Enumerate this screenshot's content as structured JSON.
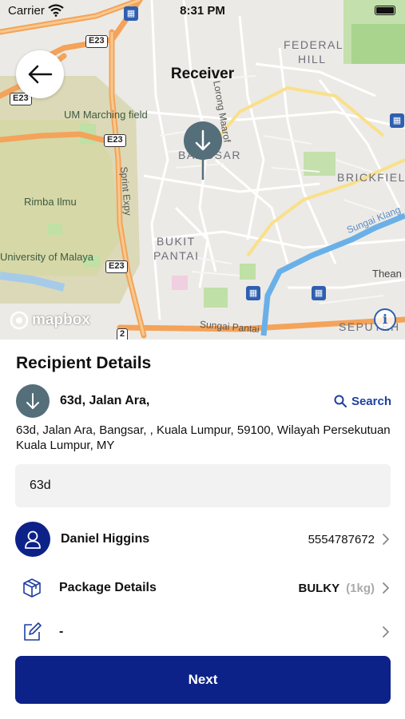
{
  "status_bar": {
    "carrier": "Carrier",
    "time": "8:31 PM"
  },
  "nav": {
    "title": "Receiver"
  },
  "map": {
    "attribution": "mapbox",
    "areas": [
      "FEDERAL",
      "HILL",
      "BANGSAR",
      "BUKIT",
      "PANTAI",
      "BRICKFIEL",
      "SEPUTEH"
    ],
    "places": [
      "UM Marching field",
      "Rimba Ilmu",
      "University of Malaya",
      "Thean"
    ],
    "roads": [
      "Lorong Maarof",
      "Sprint Expy",
      "Sungai Pantai"
    ],
    "water": "Sungai Klang",
    "shields": [
      "E23",
      "E23",
      "E23",
      "E23",
      "2"
    ]
  },
  "recipient": {
    "section_title": "Recipient Details",
    "address_short": "63d, Jalan Ara,",
    "search_label": "Search",
    "address_full": "63d, Jalan Ara, Bangsar, , Kuala Lumpur, 59100, Wilayah Persekutuan Kuala Lumpur, MY",
    "unit_value": "63d",
    "contact_name": "Daniel Higgins",
    "contact_phone": "5554787672",
    "package_label": "Package Details",
    "package_type": "BULKY",
    "package_weight": "(1kg)",
    "note": "-"
  },
  "next_label": "Next",
  "colors": {
    "primary": "#0d2288",
    "pin": "#546e7a",
    "link": "#1f3fa0"
  }
}
